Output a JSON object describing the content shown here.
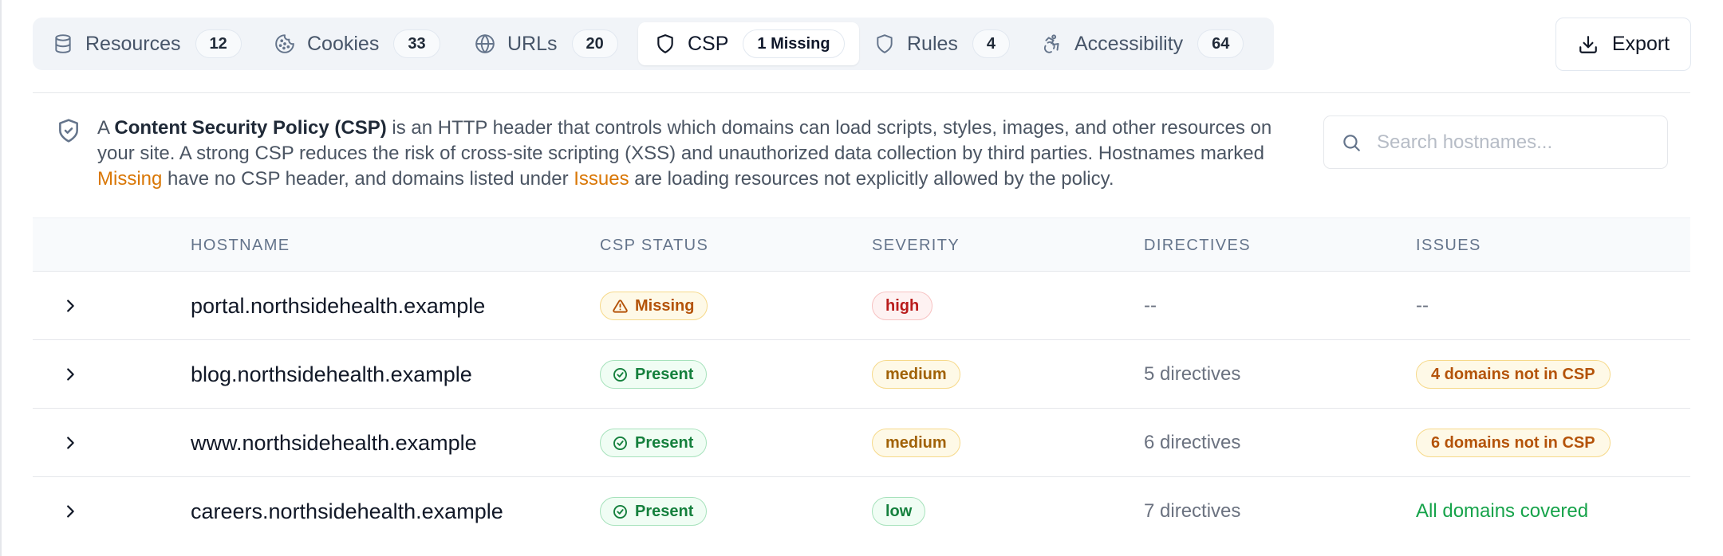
{
  "tabs": [
    {
      "label": "Resources",
      "count": "12",
      "icon": "database-icon",
      "active": false
    },
    {
      "label": "Cookies",
      "count": "33",
      "icon": "cookie-icon",
      "active": false
    },
    {
      "label": "URLs",
      "count": "20",
      "icon": "globe-icon",
      "active": false
    },
    {
      "label": "CSP",
      "count": "1 Missing",
      "icon": "shield-icon",
      "active": true
    },
    {
      "label": "Rules",
      "count": "4",
      "icon": "shield-icon",
      "active": false
    },
    {
      "label": "Accessibility",
      "count": "64",
      "icon": "accessibility-icon",
      "active": false
    }
  ],
  "export_label": "Export",
  "info": {
    "prefix": "A ",
    "bold": "Content Security Policy (CSP)",
    "middle": " is an HTTP header that controls which domains can load scripts, styles, images, and other resources on your site. A strong CSP reduces the risk of cross-site scripting (XSS) and unauthorized data collection by third parties. Hostnames marked ",
    "missing_word": "Missing",
    "middle2": " have no CSP header, and domains listed under ",
    "issues_word": "Issues",
    "suffix": " are loading resources not explicitly allowed by the policy."
  },
  "search": {
    "placeholder": "Search hostnames..."
  },
  "table": {
    "headers": {
      "hostname": "HOSTNAME",
      "status": "CSP STATUS",
      "severity": "SEVERITY",
      "directives": "DIRECTIVES",
      "issues": "ISSUES"
    },
    "rows": [
      {
        "hostname": "portal.northsidehealth.example",
        "status": "Missing",
        "severity": "high",
        "directives": "--",
        "issues": "--"
      },
      {
        "hostname": "blog.northsidehealth.example",
        "status": "Present",
        "severity": "medium",
        "directives": "5 directives",
        "issues": "4 domains not in CSP"
      },
      {
        "hostname": "www.northsidehealth.example",
        "status": "Present",
        "severity": "medium",
        "directives": "6 directives",
        "issues": "6 domains not in CSP"
      },
      {
        "hostname": "careers.northsidehealth.example",
        "status": "Present",
        "severity": "low",
        "directives": "7 directives",
        "issues": "All domains covered"
      }
    ]
  },
  "colors": {
    "accent_amber": "#d97706",
    "success_green": "#16a34a",
    "danger_red": "#b91c1c"
  }
}
